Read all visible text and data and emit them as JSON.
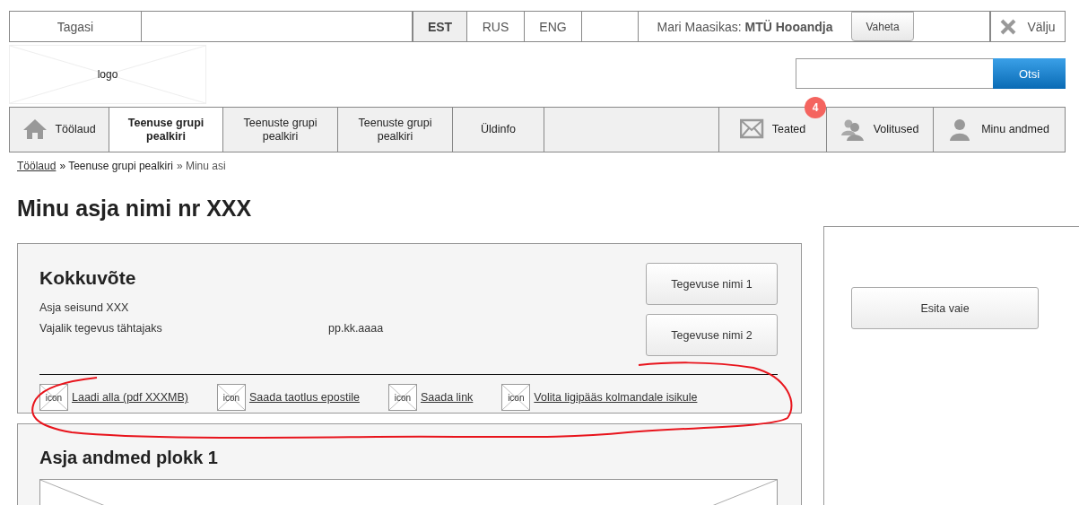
{
  "top_bar": {
    "back": "Tagasi",
    "languages": [
      {
        "label": "EST",
        "selected": true
      },
      {
        "label": "RUS",
        "selected": false
      },
      {
        "label": "ENG",
        "selected": false
      }
    ],
    "user": {
      "name": "Mari Maasikas:",
      "organization": "MTÜ Hooandja"
    },
    "switch_button": "Vaheta",
    "logout": "Välju"
  },
  "header": {
    "logo": "logo",
    "search": {
      "button": "Otsi"
    }
  },
  "nav": [
    {
      "kind": "home",
      "label": "Töölaud",
      "selected": false
    },
    {
      "kind": "plain",
      "label": "Teenuse grupi pealkiri",
      "selected": true
    },
    {
      "kind": "plain",
      "label": "Teenuste grupi pealkiri",
      "selected": false
    },
    {
      "kind": "plain",
      "label": "Teenuste grupi pealkiri",
      "selected": false
    },
    {
      "kind": "plain",
      "label": "Üldinfo",
      "selected": false
    },
    {
      "kind": "spacer"
    },
    {
      "kind": "mail",
      "label": "Teated",
      "selected": false,
      "badge": "4"
    },
    {
      "kind": "people",
      "label": "Volitused",
      "selected": false
    },
    {
      "kind": "person",
      "label": "Minu andmed",
      "selected": false
    }
  ],
  "breadcrumb": [
    {
      "text": "Töölaud",
      "link": true
    },
    {
      "text": "» Teenuse grupi pealkiri",
      "link": false
    },
    {
      "text": "» Minu asi",
      "link": false
    }
  ],
  "page_title": "Minu asja nimi nr XXX",
  "summary": {
    "title": "Kokkuvõte",
    "fields": [
      {
        "label": "Asja seisund XXX"
      },
      {
        "label": "Vajalik tegevus tähtajaks",
        "value": "pp.kk.aaaa"
      }
    ],
    "actions": [
      "Tegevuse nimi 1",
      "Tegevuse nimi 2"
    ],
    "links": [
      {
        "icon": "icon",
        "text": "Laadi alla (pdf XXXMB)"
      },
      {
        "icon": "icon",
        "text": "Saada taotlus epostile"
      },
      {
        "icon": "icon",
        "text": "Saada link"
      },
      {
        "icon": "icon",
        "text": "Volita ligipääs kolmandale isikule"
      }
    ]
  },
  "block": {
    "title": "Asja andmed plokk 1"
  },
  "side_panel": {
    "button": "Esita vaie"
  }
}
